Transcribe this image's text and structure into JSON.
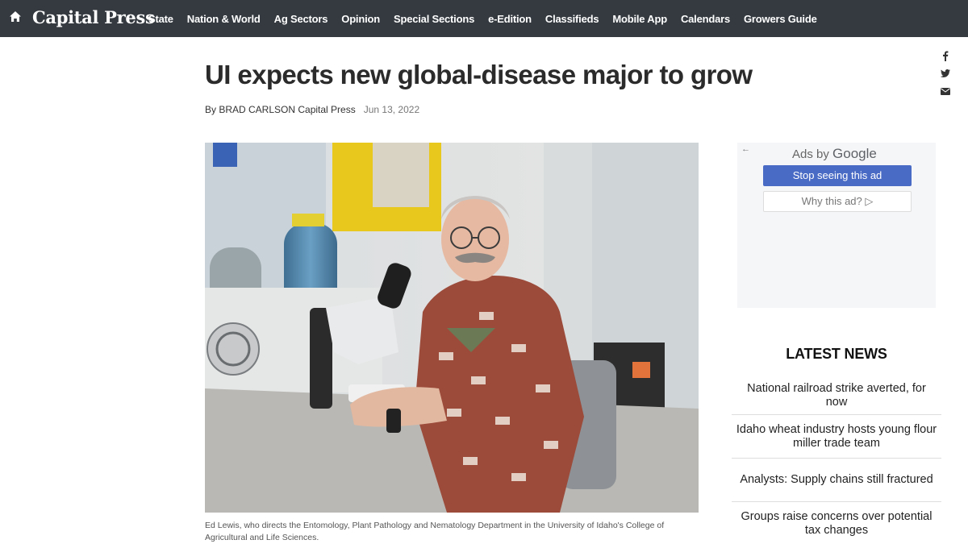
{
  "site": {
    "logo": "Capital Press",
    "nav": [
      "State",
      "Nation & World",
      "Ag Sectors",
      "Opinion",
      "Special Sections",
      "e-Edition",
      "Classifieds",
      "Mobile App",
      "Calendars",
      "Growers Guide"
    ]
  },
  "article": {
    "title": "UI expects new global-disease major to grow",
    "byline": "By BRAD CARLSON Capital Press",
    "date": "Jun 13, 2022",
    "caption": "Ed Lewis, who directs the Entomology, Plant Pathology and Nematology Department in the University of Idaho's College of Agricultural and Life Sciences."
  },
  "ad": {
    "ads_by": "Ads by",
    "google": "Google",
    "stop": "Stop seeing this ad",
    "why": "Why this ad? ▷"
  },
  "latest": {
    "heading": "LATEST NEWS",
    "items": [
      "National railroad strike averted, for now",
      "Idaho wheat industry hosts young flour miller trade team",
      "Analysts: Supply chains still fractured",
      "Groups raise concerns over potential tax changes"
    ]
  },
  "icons": {
    "home": "home-icon",
    "facebook": "facebook-icon",
    "twitter": "twitter-icon",
    "email": "email-icon",
    "back": "back-arrow-icon"
  },
  "colors": {
    "nav_bg": "#343a40",
    "ad_button": "#4a6bc5"
  }
}
